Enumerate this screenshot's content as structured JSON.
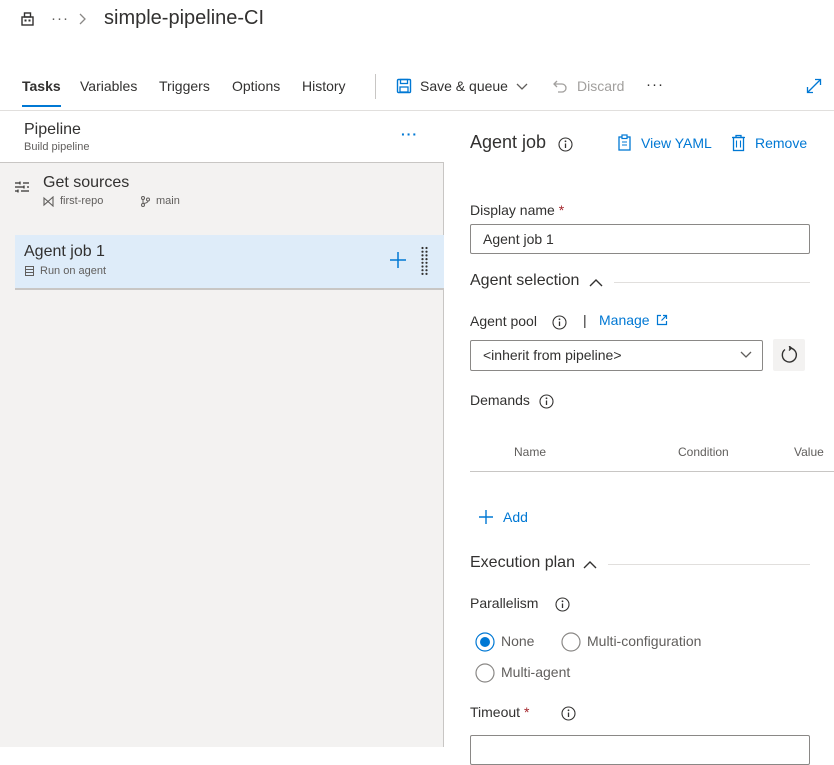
{
  "header": {
    "title": "simple-pipeline-CI",
    "ellipsis": "···"
  },
  "tabs": [
    {
      "label": "Tasks",
      "active": true
    },
    {
      "label": "Variables"
    },
    {
      "label": "Triggers"
    },
    {
      "label": "Options"
    },
    {
      "label": "History"
    }
  ],
  "toolbar": {
    "save_queue": "Save & queue",
    "discard": "Discard",
    "more": "···"
  },
  "left": {
    "pipeline_title": "Pipeline",
    "pipeline_subtitle": "Build pipeline",
    "more": "···",
    "get_sources": {
      "title": "Get sources",
      "repo": "first-repo",
      "branch": "main"
    },
    "agent_job": {
      "title": "Agent job 1",
      "subtitle": "Run on agent"
    }
  },
  "right": {
    "title": "Agent job",
    "view_yaml": "View YAML",
    "remove": "Remove",
    "display_name_label": "Display name",
    "required_mark": "*",
    "display_name_value": "Agent job 1",
    "agent_selection": "Agent selection",
    "agent_pool_label": "Agent pool",
    "pipe_sep": "|",
    "manage": "Manage",
    "agent_pool_value": "<inherit from pipeline>",
    "demands_label": "Demands",
    "demands_columns": [
      "Name",
      "Condition",
      "Value"
    ],
    "add": "Add",
    "execution_plan": "Execution plan",
    "parallelism_label": "Parallelism",
    "parallelism_options": [
      "None",
      "Multi-configuration",
      "Multi-agent"
    ],
    "parallelism_selected": "None",
    "timeout_label": "Timeout"
  },
  "colors": {
    "accent": "#0078d4",
    "selected_row": "#deecf9",
    "pane_bg": "#f3f2f1",
    "required": "#a4262c"
  }
}
